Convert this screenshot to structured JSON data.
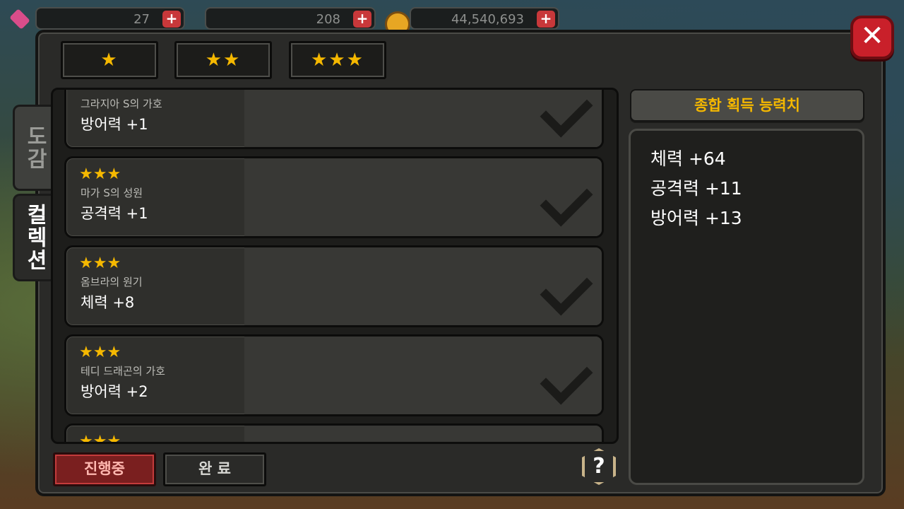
{
  "resources": {
    "gems": "27",
    "energy": "208",
    "gold": "44,540,693"
  },
  "tabs_top": [
    "★",
    "★★",
    "★★★"
  ],
  "side_tabs": {
    "encyclopedia": "도감",
    "collection": "컬렉션"
  },
  "items": [
    {
      "stars": "",
      "name": "그라지아 S의 가호",
      "stat": "방어력 +1"
    },
    {
      "stars": "★★★",
      "name": "마가 S의 성원",
      "stat": "공격력 +1"
    },
    {
      "stars": "★★★",
      "name": "옴브라의 원기",
      "stat": "체력 +8"
    },
    {
      "stars": "★★★",
      "name": "테디 드래곤의 가호",
      "stat": "방어력 +2"
    },
    {
      "stars": "★★★",
      "name": "",
      "stat": ""
    }
  ],
  "summary": {
    "title": "종합 획득 능력치",
    "lines": [
      "체력 +64",
      "공격력 +11",
      "방어력 +13"
    ]
  },
  "buttons": {
    "in_progress": "진행중",
    "complete": "완 료",
    "help": "?"
  },
  "colors": {
    "accent": "#f5b800",
    "close": "#c9202a",
    "panel": "#2a2a28"
  }
}
